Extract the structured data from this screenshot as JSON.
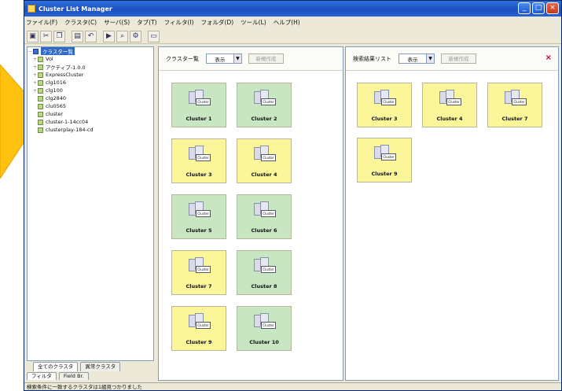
{
  "window": {
    "title": "Cluster List Manager",
    "buttons": [
      "_",
      "□",
      "×"
    ]
  },
  "menu": [
    "ファイル(F)",
    "クラスタ(C)",
    "サーバ(S)",
    "タブ(T)",
    "フィルタ(I)",
    "フォルダ(D)",
    "ツール(L)",
    "ヘルプ(H)"
  ],
  "toolbar": {
    "icons": [
      "save-icon",
      "cut-icon",
      "copy-icon",
      "paste-icon",
      "undo-icon",
      "run-icon",
      "find-icon",
      "settings-icon",
      "window-icon"
    ]
  },
  "tree": {
    "root": "クラスター覧",
    "items": [
      "Vol",
      "アクティブ-1.0.0",
      "ExpressCluster",
      "clg1016",
      "clg100",
      "clg2840",
      "clu0565",
      "cluster",
      "cluster-1-14cc04",
      "clusterplay-184-cd"
    ]
  },
  "left_tabs": {
    "active": "全てのクラスタ",
    "inactive": "異常クラスタ"
  },
  "left_subtabs": [
    "フィルタ",
    "Field Br."
  ],
  "status": "検索条件に一致するクラスタは1組見つかりました",
  "panel_main": {
    "title": "クラスター覧",
    "combo_value": "表示",
    "button": "新規作成",
    "cards": [
      {
        "label": "Cluster 1",
        "color": "green"
      },
      {
        "label": "Cluster 2",
        "color": "green"
      },
      {
        "label": "Cluster 3",
        "color": "yellow"
      },
      {
        "label": "Cluster 4",
        "color": "yellow"
      },
      {
        "label": "Cluster 5",
        "color": "green"
      },
      {
        "label": "Cluster 6",
        "color": "green"
      },
      {
        "label": "Cluster 7",
        "color": "yellow"
      },
      {
        "label": "Cluster 8",
        "color": "green"
      },
      {
        "label": "Cluster 9",
        "color": "yellow"
      },
      {
        "label": "Cluster 10",
        "color": "green"
      }
    ]
  },
  "panel_search": {
    "title": "検索結果リスト",
    "combo_value": "表示",
    "button": "新規作成",
    "close": "×",
    "cards": [
      {
        "label": "Cluster 3",
        "color": "yellow"
      },
      {
        "label": "Cluster 4",
        "color": "yellow"
      },
      {
        "label": "Cluster 7",
        "color": "yellow"
      },
      {
        "label": "Cluster 9",
        "color": "yellow"
      }
    ]
  },
  "colors": {
    "green_card": "#c7e6c1",
    "yellow_card": "#fbf69a",
    "arrow": "#ffc20e",
    "titlebar": "#1a4fc0"
  }
}
